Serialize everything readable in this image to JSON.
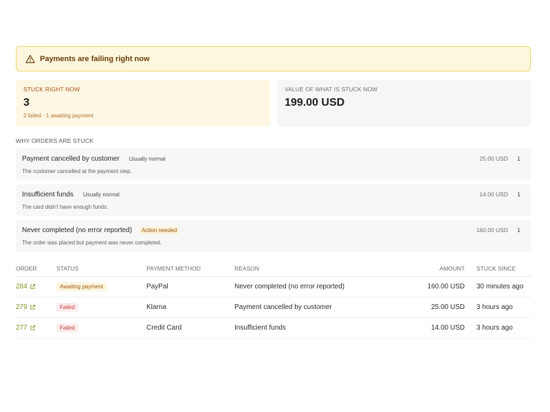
{
  "alert": {
    "title": "Payments are failing right now",
    "icon": "warning-triangle-icon"
  },
  "stats": {
    "stuck": {
      "label": "STUCK RIGHT NOW",
      "value": "3",
      "sub": "2 failed · 1 awaiting payment"
    },
    "value": {
      "label": "VALUE OF WHAT IS STUCK NOW",
      "value": "199.00 USD"
    }
  },
  "reasons_section": {
    "title": "WHY ORDERS ARE STUCK",
    "items": [
      {
        "title": "Payment cancelled by customer",
        "tag": "Usually normal",
        "desc": "The customer cancelled at the payment step.",
        "amount": "25.00 USD",
        "count": "1"
      },
      {
        "title": "Insufficient funds",
        "tag": "Usually normal",
        "desc": "The card didn't have enough funds.",
        "amount": "14.00 USD",
        "count": "1"
      },
      {
        "title": "Never completed (no error reported)",
        "tag": "Action needed",
        "desc": "The order was placed but payment was never completed.",
        "amount": "160.00 USD",
        "count": "1"
      }
    ]
  },
  "table": {
    "headers": [
      "ORDER",
      "STATUS",
      "PAYMENT METHOD",
      "REASON",
      "AMOUNT",
      "STUCK SINCE"
    ],
    "rows": [
      {
        "order": "284",
        "status": "Awaiting payment",
        "method": "PayPal",
        "reason": "Never completed (no error reported)",
        "amount": "160.00 USD",
        "since": "30 minutes ago"
      },
      {
        "order": "279",
        "status": "Failed",
        "method": "Klarna",
        "reason": "Payment cancelled by customer",
        "amount": "25.00 USD",
        "since": "3 hours ago"
      },
      {
        "order": "277",
        "status": "Failed",
        "method": "Credit Card",
        "reason": "Insufficient funds",
        "amount": "14.00 USD",
        "since": "3 hours ago"
      }
    ]
  },
  "colors": {
    "warning": "#6b3a0c",
    "link": "#7a9422",
    "failed": "#c53a3a",
    "awaiting": "#a0530f"
  }
}
